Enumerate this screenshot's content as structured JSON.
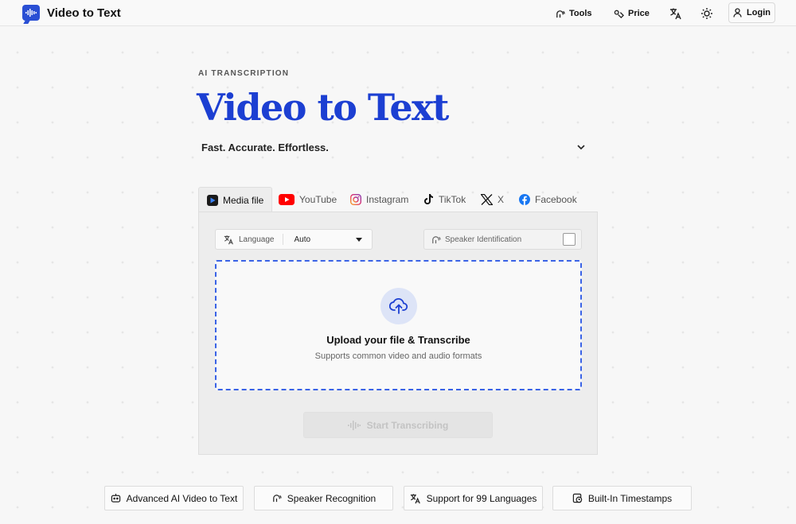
{
  "header": {
    "brand_name": "Video to Text",
    "nav": {
      "tools_label": "Tools",
      "price_label": "Price",
      "login_label": "Login"
    }
  },
  "hero": {
    "eyebrow": "AI TRANSCRIPTION",
    "title": "Video to Text",
    "subtitle": "Fast. Accurate. Effortless."
  },
  "tabs": [
    {
      "label": "Media file",
      "icon": "media-file-icon",
      "active": true
    },
    {
      "label": "YouTube",
      "icon": "youtube-icon",
      "active": false
    },
    {
      "label": "Instagram",
      "icon": "instagram-icon",
      "active": false
    },
    {
      "label": "TikTok",
      "icon": "tiktok-icon",
      "active": false
    },
    {
      "label": "X",
      "icon": "x-icon",
      "active": false
    },
    {
      "label": "Facebook",
      "icon": "facebook-icon",
      "active": false
    }
  ],
  "panel": {
    "language_label": "Language",
    "language_value": "Auto",
    "speaker_label": "Speaker Identification",
    "speaker_checked": false,
    "upload_title": "Upload your file & Transcribe",
    "upload_subtitle": "Supports common video and audio formats",
    "start_label": "Start Transcribing"
  },
  "features": [
    {
      "label": "Advanced AI Video to Text",
      "icon": "ai-bot-icon"
    },
    {
      "label": "Speaker Recognition",
      "icon": "speaker-icon"
    },
    {
      "label": "Support for 99 Languages",
      "icon": "translate-icon"
    },
    {
      "label": "Built-In Timestamps",
      "icon": "clock-icon"
    }
  ],
  "colors": {
    "accent": "#1c3fd2",
    "dropzone_border": "#3a63e6",
    "youtube": "#ff0000",
    "facebook": "#1877f2"
  }
}
